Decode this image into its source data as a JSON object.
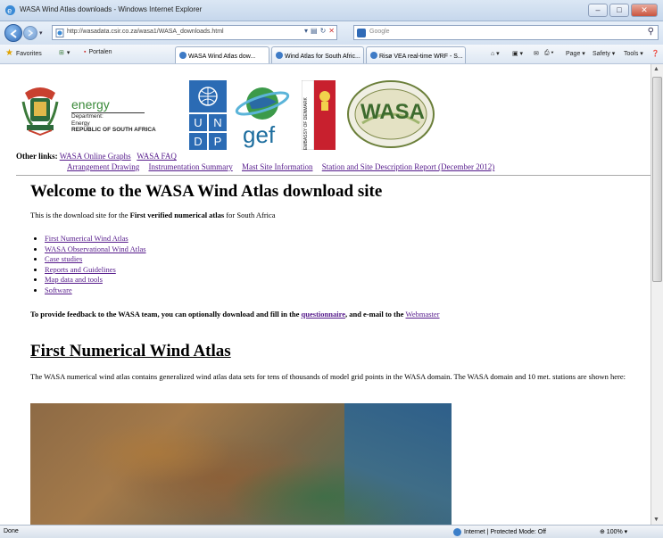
{
  "window": {
    "title": "WASA Wind Atlas downloads - Windows Internet Explorer",
    "controls": [
      "–",
      "□",
      "✕"
    ]
  },
  "address_bar": {
    "url": "http://wasadata.csir.co.za/wasa1/WASA_downloads.html",
    "search_placeholder": "Google"
  },
  "favorites_bar": {
    "favorites_label": "Favorites",
    "portalen_label": "Portalen",
    "tabs": [
      "WASA Wind Atlas dow...",
      "Wind Atlas for South Afric...",
      "Risø VEA real-time WRF - S..."
    ],
    "commands": {
      "page": "Page ▾",
      "safety": "Safety ▾",
      "tools": "Tools ▾"
    }
  },
  "header": {
    "energy": {
      "word": "energy",
      "line1": "Department:",
      "line2": "Energy",
      "line3": "REPUBLIC OF SOUTH AFRICA"
    },
    "undp_letters": [
      "U",
      "N",
      "D",
      "P"
    ],
    "gef_text": "gef",
    "denmark_text": "EMBASSY OF DENMARK",
    "wasa_text": "WASA",
    "other_links_label": "Other links:",
    "links_row1": [
      "WASA Online Graphs",
      "WASA FAQ"
    ],
    "links_row2": [
      "Arrangement Drawing",
      "Instrumentation Summary",
      "Mast Site Information",
      "Station and Site Description Report (December 2012)"
    ]
  },
  "main": {
    "heading": "Welcome to the WASA Wind Atlas download site",
    "intro_prefix": "This is the download site for the ",
    "intro_bold": "First verified numerical atlas",
    "intro_suffix": " for South Africa",
    "sections": [
      "First Numerical Wind Atlas",
      "WASA Observational Wind Atlas",
      "Case studies",
      "Reports and Guidelines",
      "Map data and tools",
      "Software"
    ],
    "feedback_prefix": "To provide feedback to the WASA team, you can optionally download and fill in the ",
    "feedback_link1": "questionnaire",
    "feedback_middle": ", and e-mail to the ",
    "feedback_link2": "Webmaster",
    "section_heading": "First Numerical Wind Atlas",
    "section_desc": "The WASA numerical wind atlas contains generalized wind atlas data sets for tens of thousands of model grid points in the WASA domain. The WASA domain and 10 met. stations are shown here:"
  },
  "status_bar": {
    "left": "Done",
    "zone": "Internet | Protected Mode: Off",
    "zoom": "⊕ 100% ▾"
  }
}
